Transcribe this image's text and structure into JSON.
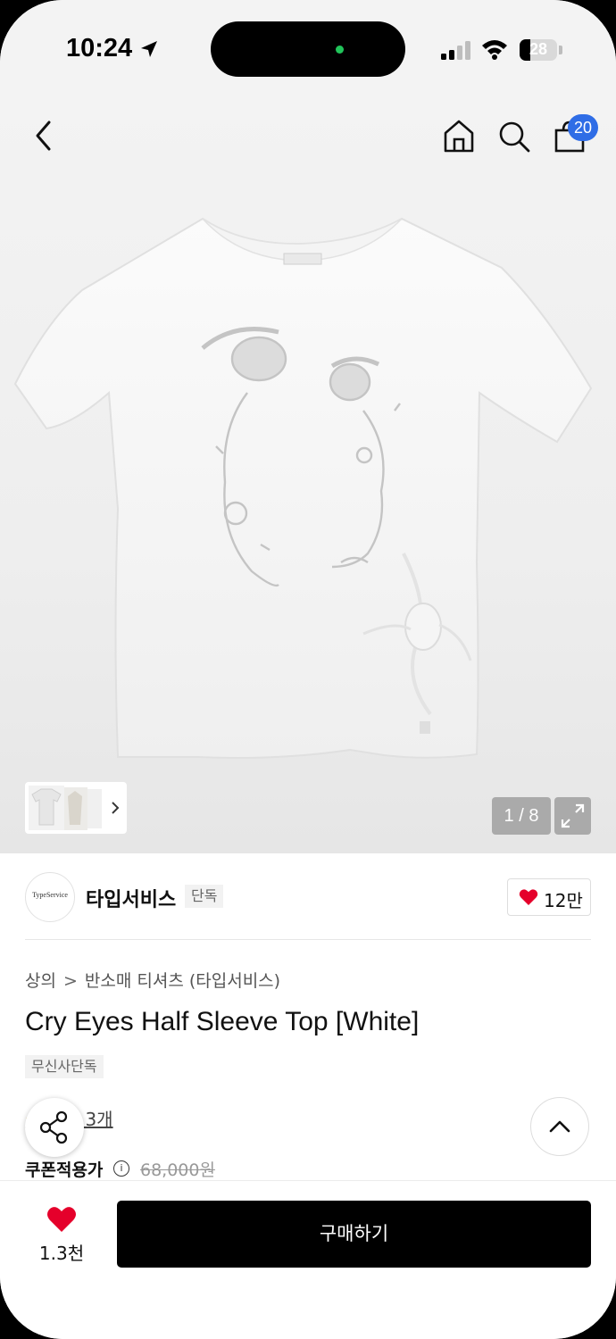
{
  "status_bar": {
    "time": "10:24",
    "battery": "28"
  },
  "top_nav": {
    "back_icon": "chevron-left-icon",
    "home_icon": "home-icon",
    "search_icon": "search-icon",
    "cart_icon": "shopping-bag-icon",
    "cart_count": "20"
  },
  "gallery": {
    "page_indicator": "1 / 8",
    "expand_icon": "expand-icon"
  },
  "brand": {
    "logo_text": "TypeService",
    "name": "타입서비스",
    "badge": "단독",
    "likes": "12만"
  },
  "product": {
    "breadcrumb": [
      "상의",
      "반소매 티셔츠 (타입서비스)"
    ],
    "title": "Cry Eyes Half Sleeve Top [White]",
    "tag": "무신사단독",
    "reviews": "후기 3개",
    "price_label": "쿠폰적용가",
    "original_price": "68,000원"
  },
  "bottom_bar": {
    "wishlist_count": "1.3천",
    "buy_label": "구매하기"
  },
  "colors": {
    "accent_badge": "#2f6de6",
    "heart": "#e5002b",
    "buy_button": "#000000"
  }
}
